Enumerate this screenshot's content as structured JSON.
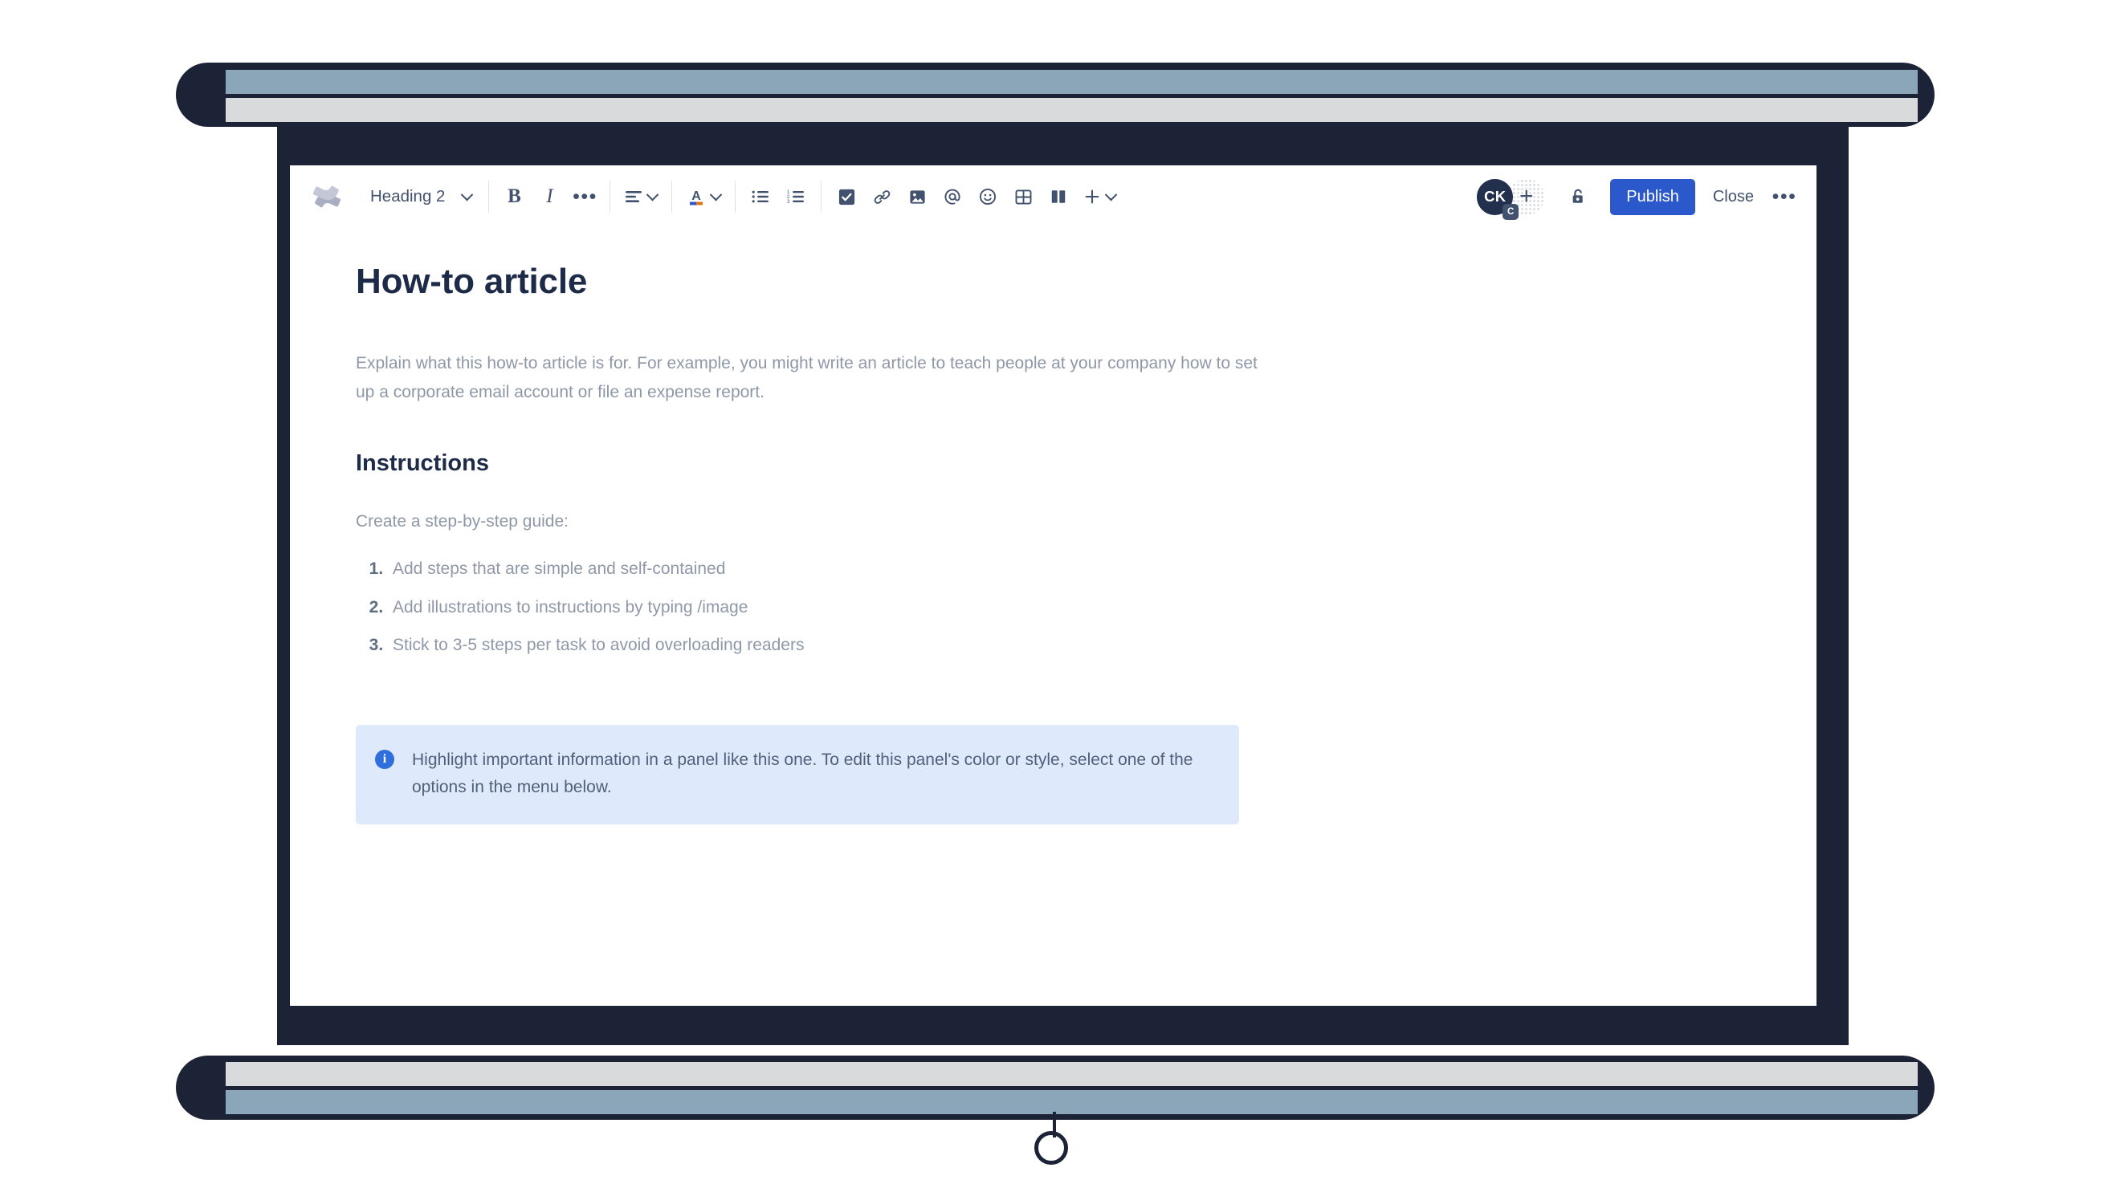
{
  "scene": {
    "name": "Projector screen showing Confluence page editor",
    "frame_color": "#1d2336",
    "stripe_blue": "#8aa6b8",
    "stripe_gray": "#d9dadb",
    "surface_color": "#ffffff"
  },
  "toolbar": {
    "logo_label": "Confluence",
    "heading_select": {
      "value": "Heading 2",
      "chevron": "chevron-down-icon"
    },
    "format_buttons": [
      {
        "name": "bold-button",
        "label": "B"
      },
      {
        "name": "italic-button",
        "label": "I"
      },
      {
        "name": "more-formatting-button",
        "label": "•••"
      }
    ],
    "align_button": {
      "name": "text-align-button",
      "label": "Text alignment"
    },
    "text_color_button": {
      "name": "text-color-button",
      "label": "A",
      "swatch_left": "#2b58cb",
      "swatch_right": "#e8710a"
    },
    "list_buttons": [
      {
        "name": "bullet-list-button",
        "label": "Bulleted list"
      },
      {
        "name": "numbered-list-button",
        "label": "Numbered list"
      }
    ],
    "insert_buttons": [
      {
        "name": "action-item-button",
        "label": "Action item"
      },
      {
        "name": "link-button",
        "label": "Link"
      },
      {
        "name": "image-button",
        "label": "Image"
      },
      {
        "name": "mention-button",
        "label": "Mention"
      },
      {
        "name": "emoji-button",
        "label": "Emoji"
      },
      {
        "name": "table-button",
        "label": "Table"
      },
      {
        "name": "layout-button",
        "label": "Layouts"
      }
    ],
    "insert_more": {
      "name": "insert-more-button",
      "label": "+"
    },
    "avatar": {
      "initials": "CK",
      "badge": "C",
      "color": "#22304d"
    },
    "add_person": {
      "label": "+"
    },
    "restrictions": {
      "name": "unlock-icon",
      "label": "Restrictions"
    },
    "publish_label": "Publish",
    "close_label": "Close",
    "overflow_label": "•••",
    "publish_color": "#2b58cb"
  },
  "document": {
    "title": "How-to article",
    "intro": "Explain what this how-to article is for. For example, you might write an article to teach people at your company how to set up a corporate email account or file an expense report.",
    "section_heading": "Instructions",
    "section_lead": "Create a step-by-step guide:",
    "steps": [
      "Add steps that are simple and self-contained",
      "Add illustrations to instructions by typing /image",
      "Stick to 3-5 steps per task to avoid overloading readers"
    ],
    "info_panel": {
      "icon": "info-icon",
      "text": "Highlight important information in a panel like this one. To edit this panel's color or style, select one of the options in the menu below.",
      "background": "#deeafc",
      "icon_color": "#2f6fdb"
    }
  }
}
